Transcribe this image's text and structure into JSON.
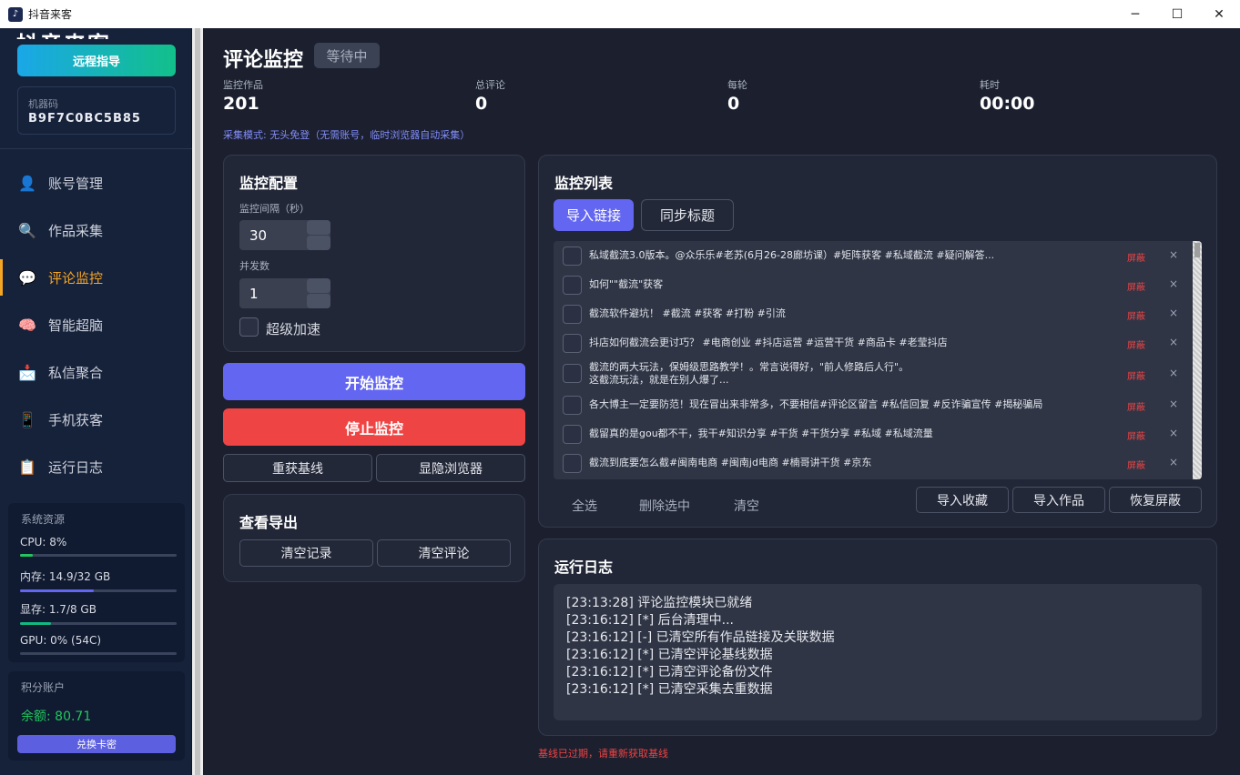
{
  "window": {
    "title": "抖音来客",
    "app_icon": "app-icon",
    "min": "─",
    "max": "☐",
    "close": "✕"
  },
  "sidebar": {
    "brand": "抖音来客",
    "remote_label": "远程指导",
    "machine": {
      "label": "机器码",
      "value": "B9F7C0BC5B85"
    },
    "nav": [
      {
        "label": "账号管理",
        "icon": "user-icon",
        "glyph": "👤"
      },
      {
        "label": "作品采集",
        "icon": "search-icon",
        "glyph": "🔍"
      },
      {
        "label": "评论监控",
        "icon": "chat-icon",
        "glyph": "💬"
      },
      {
        "label": "智能超脑",
        "icon": "brain-icon",
        "glyph": "🧠"
      },
      {
        "label": "私信聚合",
        "icon": "mail-icon",
        "glyph": "📩"
      },
      {
        "label": "手机获客",
        "icon": "phone-icon",
        "glyph": "📱"
      },
      {
        "label": "运行日志",
        "icon": "clipboard-icon",
        "glyph": "📋"
      }
    ],
    "active_index": 2,
    "resources": {
      "title": "系统资源",
      "cpu": {
        "label": "CPU: 8%",
        "level": 0.08,
        "color": "#22c55e"
      },
      "mem": {
        "label": "内存: 14.9/32 GB",
        "level": 0.47,
        "color": "#6366f1"
      },
      "gpu_mem": {
        "label": "显存: 1.7/8 GB",
        "level": 0.2,
        "color": "#10b981"
      },
      "gpu": {
        "label": "GPU: 0% (54C)",
        "level": 0.0,
        "color": "#22c55e"
      }
    },
    "points": {
      "title": "积分账户",
      "balance": "余额: 80.71",
      "redeem_label": "兑换卡密"
    }
  },
  "header": {
    "title": "评论监控",
    "status": "等待中",
    "stats": [
      {
        "label": "监控作品",
        "value": "201"
      },
      {
        "label": "总评论",
        "value": "0"
      },
      {
        "label": "每轮",
        "value": "0"
      },
      {
        "label": "耗时",
        "value": "00:00"
      }
    ],
    "mode_text": "采集模式: 无头免登（无需账号，临时浏览器自动采集）"
  },
  "config": {
    "title": "监控配置",
    "interval_label": "监控间隔（秒）",
    "interval_value": "30",
    "concurrency_label": "并发数",
    "concurrency_value": "1",
    "turbo_label": "超级加速",
    "start_label": "开始监控",
    "stop_label": "停止监控",
    "rebase_label": "重获基线",
    "toggle_browser_label": "显隐浏览器"
  },
  "export": {
    "title": "查看导出",
    "clear_records": "清空记录",
    "clear_comments": "清空评论"
  },
  "monitor_list": {
    "title": "监控列表",
    "import_link": "导入链接",
    "sync_title": "同步标题",
    "shield_label": "屏蔽",
    "delete_glyph": "×",
    "items": [
      "私域截流3.0版本。@众乐乐#老苏(6月26-28廊坊课）#矩阵获客 #私域截流 #疑问解答...",
      "如何\"\"截流\"获客",
      "截流软件避坑！ #截流 #获客 #打粉 #引流",
      "抖店如何截流会更讨巧？ #电商创业 #抖店运营 #运营干货 #商品卡 #老莹抖店",
      "截流的两大玩法，保姆级思路教学！。常言说得好，\"前人修路后人行\"。",
      "这截流玩法，就是在别人爆了...",
      "各大博主一定要防范！现在冒出来非常多，不要相信#评论区留言 #私信回复 #反诈骗宣传 #揭秘骗局",
      "截留真的是gou都不干，我干#知识分享 #干货 #干货分享 #私域 #私域流量",
      "截流到底要怎么截#闽南电商 #闽南jd电商 #楠哥讲干货 #京东"
    ],
    "select_all": "全选",
    "delete_selected": "删除选中",
    "clear": "清空",
    "import_fav": "导入收藏",
    "import_works": "导入作品",
    "restore_shield": "恢复屏蔽"
  },
  "run_log": {
    "title": "运行日志",
    "lines": [
      "[23:13:28] 评论监控模块已就绪",
      "[23:16:12] [*] 后台清理中...",
      "[23:16:12] [-] 已清空所有作品链接及关联数据",
      "[23:16:12] [*] 已清空评论基线数据",
      "[23:16:12] [*] 已清空评论备份文件",
      "[23:16:12] [*] 已清空采集去重数据"
    ]
  },
  "warning": "基线已过期，请重新获取基线",
  "colors": {
    "accent": "#6366f1",
    "danger": "#ef4444",
    "active": "#f5a524",
    "success": "#22c55e"
  }
}
